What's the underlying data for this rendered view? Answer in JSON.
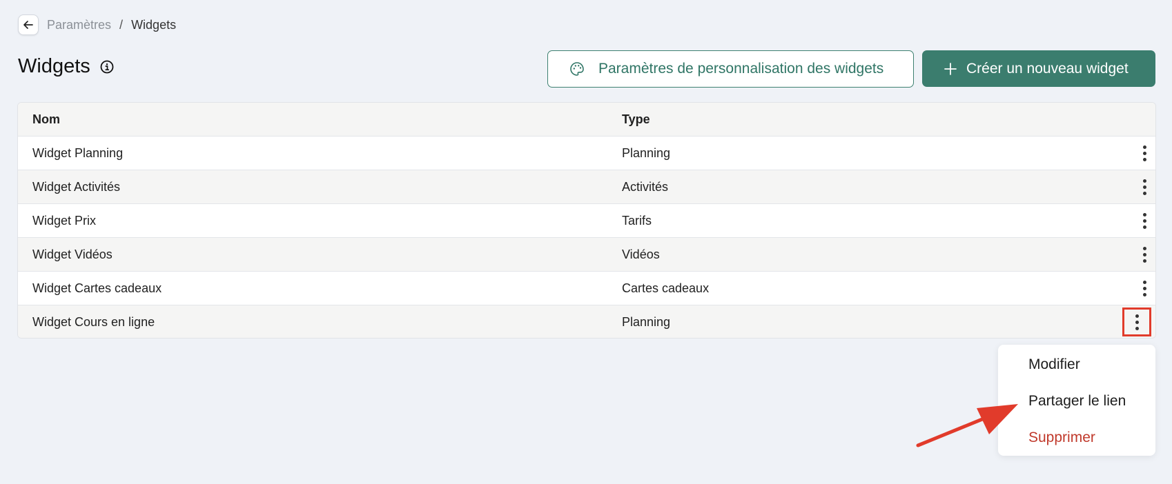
{
  "breadcrumb": {
    "parent": "Paramètres",
    "separator": "/",
    "current": "Widgets"
  },
  "page": {
    "title": "Widgets"
  },
  "actions": {
    "customize_label": "Paramètres de personnalisation des widgets",
    "create_label": "Créer un nouveau widget"
  },
  "table": {
    "columns": {
      "name": "Nom",
      "type": "Type"
    },
    "rows": [
      {
        "name": "Widget Planning",
        "type": "Planning"
      },
      {
        "name": "Widget Activités",
        "type": "Activités"
      },
      {
        "name": "Widget Prix",
        "type": "Tarifs"
      },
      {
        "name": "Widget Vidéos",
        "type": "Vidéos"
      },
      {
        "name": "Widget Cartes cadeaux",
        "type": "Cartes cadeaux"
      },
      {
        "name": "Widget Cours en ligne",
        "type": "Planning"
      }
    ]
  },
  "menu": {
    "edit": "Modifier",
    "share": "Partager le lien",
    "delete": "Supprimer"
  },
  "colors": {
    "accent": "#3b7d6e",
    "danger": "#c0392b",
    "annotation": "#e13b2b",
    "background": "#eff2f7"
  },
  "icons": {
    "back": "arrow-left-icon",
    "info": "info-circle-icon",
    "palette": "palette-icon",
    "plus": "plus-icon",
    "row_menu": "kebab-menu-icon"
  }
}
